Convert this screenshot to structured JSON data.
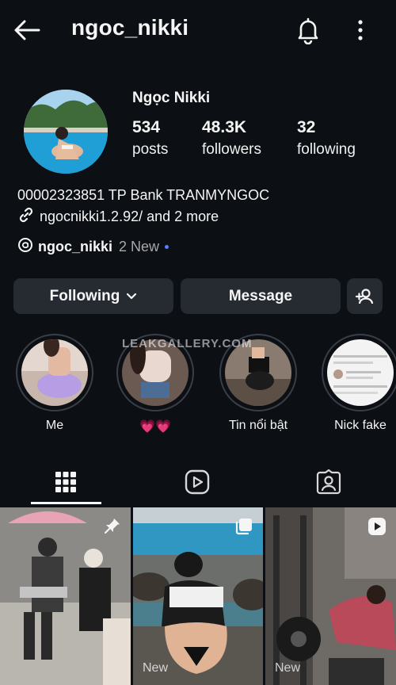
{
  "header": {
    "username": "ngoc_nikki",
    "icons": [
      "back-arrow-icon",
      "bell-icon",
      "more-vertical-icon"
    ]
  },
  "profile": {
    "display_name": "Ngọc Nikki",
    "stats": [
      {
        "value": "534",
        "label": "posts"
      },
      {
        "value": "48.3K",
        "label": "followers"
      },
      {
        "value": "32",
        "label": "following"
      }
    ],
    "bio_line": "00002323851 TP Bank TRANMYNGOC",
    "link_text": "ngocnikki1.2.92/ and 2 more",
    "threads_handle": "ngoc_nikki",
    "threads_new": "2 New"
  },
  "actions": {
    "following": "Following",
    "message": "Message"
  },
  "highlights": [
    {
      "label": "Me"
    },
    {
      "label": "💗💗"
    },
    {
      "label": "Tin nổi bật"
    },
    {
      "label": "Nick fake"
    }
  ],
  "watermark": "LEAKGALLERY.COM",
  "tabs": [
    "grid-icon",
    "reels-icon",
    "tagged-icon"
  ],
  "posts": [
    {
      "badge": "pin-icon",
      "tag": ""
    },
    {
      "badge": "carousel-icon",
      "tag": "New"
    },
    {
      "badge": "reel-icon",
      "tag": "New"
    }
  ],
  "colors": {
    "background": "#0c0f14",
    "button": "#262a31",
    "accent_dot": "#5b7cff"
  }
}
